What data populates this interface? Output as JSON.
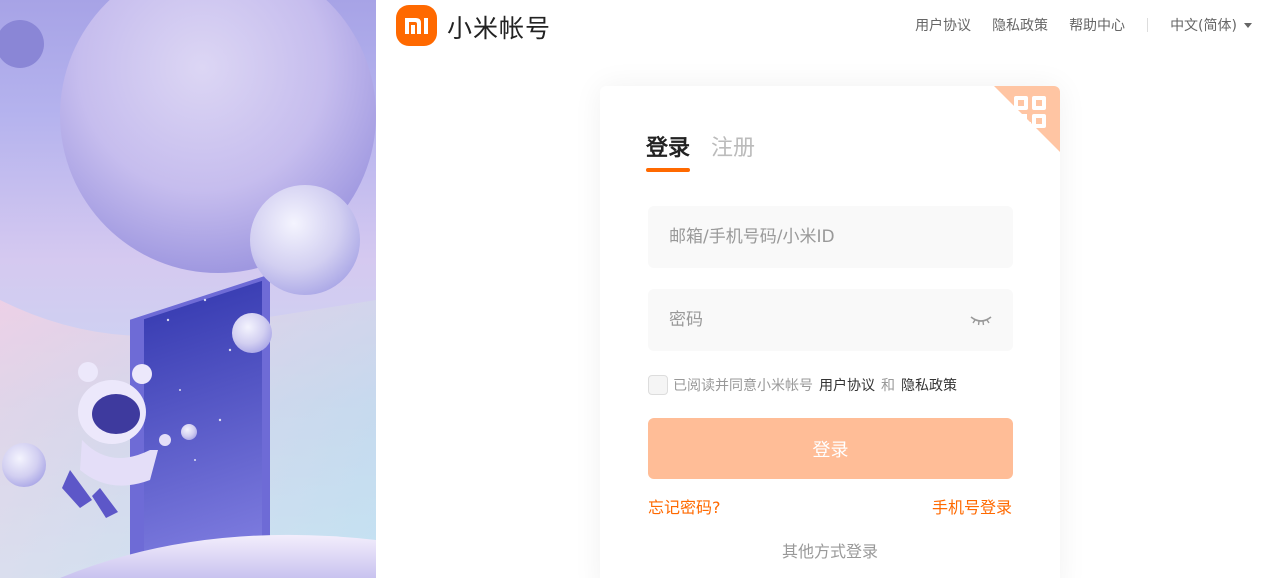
{
  "header": {
    "brand": "小米帐号",
    "nav": [
      "用户协议",
      "隐私政策",
      "帮助中心"
    ],
    "language": "中文(简体)"
  },
  "login": {
    "tabs": [
      "登录",
      "注册"
    ],
    "account_placeholder": "邮箱/手机号码/小米ID",
    "password_placeholder": "密码",
    "agree_prefix": "已阅读并同意小米帐号",
    "agree_terms": "用户协议",
    "agree_and": "和",
    "agree_privacy": "隐私政策",
    "submit": "登录",
    "forgot": "忘记密码?",
    "phone_login": "手机号登录",
    "other_methods": "其他方式登录"
  },
  "colors": {
    "brand": "#ff6900",
    "button_disabled": "#ffbd97"
  },
  "icons": [
    "mi-logo-icon",
    "qr-code-icon",
    "eye-closed-icon",
    "caret-down-icon"
  ]
}
